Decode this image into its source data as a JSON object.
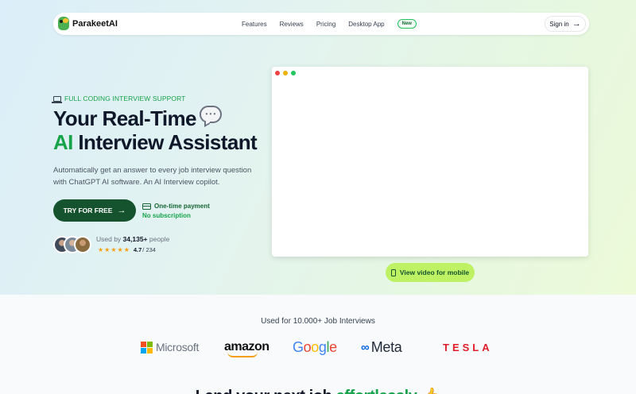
{
  "nav": {
    "brand": "ParakeetAI",
    "links": [
      "Features",
      "Reviews",
      "Pricing",
      "Desktop App"
    ],
    "new_badge": "New",
    "signin": "Sign in"
  },
  "hero": {
    "eyebrow": "FULL CODING INTERVIEW SUPPORT",
    "headline_line1": "Your Real-Time",
    "headline_line2_accent": "AI",
    "headline_line2_rest": " Interview Assistant",
    "subtext": "Automatically get an answer to every job interview question with ChatGPT AI software. An AI Interview copilot.",
    "cta": "TRY FOR FREE",
    "payment": "One-time payment",
    "no_subscription": "No subscription",
    "used_by_prefix": "Used by ",
    "used_by_count": "34,135+",
    "used_by_suffix": " people",
    "rating_value": "4.7",
    "rating_count": " / 234",
    "rating_stars": 5,
    "mobile_video": "View video for mobile"
  },
  "logos": {
    "title": "Used for 10.000+ Job Interviews",
    "microsoft": "Microsoft",
    "amazon": "amazon",
    "google": [
      "G",
      "o",
      "o",
      "g",
      "l",
      "e"
    ],
    "google_colors": [
      "#4285F4",
      "#EA4335",
      "#FBBC05",
      "#4285F4",
      "#34A853",
      "#EA4335"
    ],
    "meta": "Meta",
    "tesla": "TESLA"
  },
  "next_section": {
    "heading_start": "Land your next job ",
    "heading_accent": "effortlessly",
    "heading_emoji": " 👍"
  },
  "colors": {
    "accent_green": "#16a34a",
    "cta_dark_green": "#14532d",
    "mobile_button": "#bef264",
    "microsoft": [
      "#F25022",
      "#7FBA00",
      "#00A4EF",
      "#FFB900"
    ]
  }
}
